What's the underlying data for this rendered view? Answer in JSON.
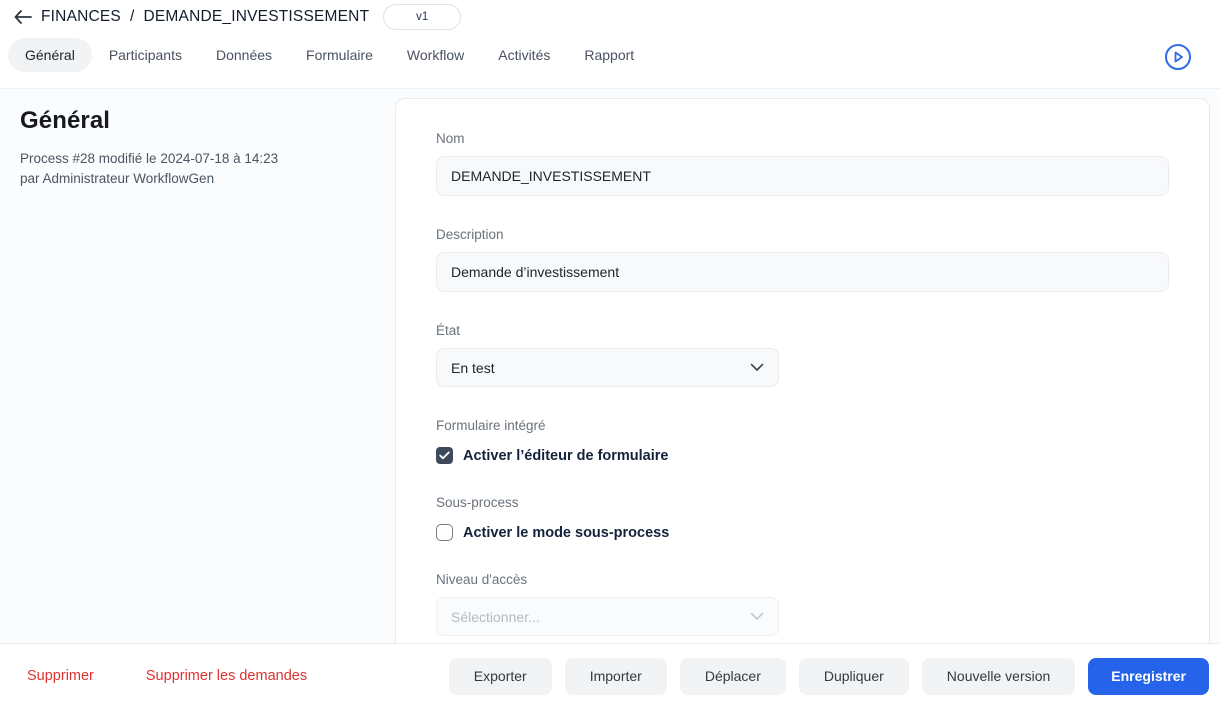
{
  "header": {
    "breadcrumb": {
      "back_icon": "arrow-left-icon",
      "parent": "FINANCES",
      "separator": "/",
      "current": "DEMANDE_INVESTISSEMENT",
      "version_badge": "v1"
    },
    "tabs": [
      {
        "label": "Général",
        "active": true
      },
      {
        "label": "Participants",
        "active": false
      },
      {
        "label": "Données",
        "active": false
      },
      {
        "label": "Formulaire",
        "active": false
      },
      {
        "label": "Workflow",
        "active": false
      },
      {
        "label": "Activités",
        "active": false
      },
      {
        "label": "Rapport",
        "active": false
      }
    ],
    "run_button_icon": "play-circle-icon"
  },
  "left_panel": {
    "title": "Général",
    "meta_line1": "Process #28 modifié le 2024-07-18 à 14:23",
    "meta_line2": "par Administrateur WorkflowGen"
  },
  "form": {
    "nom": {
      "label": "Nom",
      "value": "DEMANDE_INVESTISSEMENT"
    },
    "description": {
      "label": "Description",
      "value": "Demande d’investissement"
    },
    "etat": {
      "label": "État",
      "value": "En test"
    },
    "formulaire_integre": {
      "label": "Formulaire intégré",
      "checkbox_label": "Activer l’éditeur de formulaire",
      "checked": true
    },
    "sous_process": {
      "label": "Sous-process",
      "checkbox_label": "Activer le mode sous-process",
      "checked": false
    },
    "niveau_acces": {
      "label": "Niveau d'accès",
      "placeholder": "Sélectionner...",
      "disabled": true
    }
  },
  "footer": {
    "delete_label": "Supprimer",
    "delete_requests_label": "Supprimer les demandes",
    "buttons": [
      "Exporter",
      "Importer",
      "Déplacer",
      "Dupliquer",
      "Nouvelle version"
    ],
    "save_label": "Enregistrer"
  },
  "colors": {
    "accent_blue": "#2563eb",
    "danger_red": "#e03131",
    "checkbox_checked": "#3d4a5c",
    "active_tab_bg": "#f1f3f5",
    "input_bg": "#f8f9fa"
  }
}
